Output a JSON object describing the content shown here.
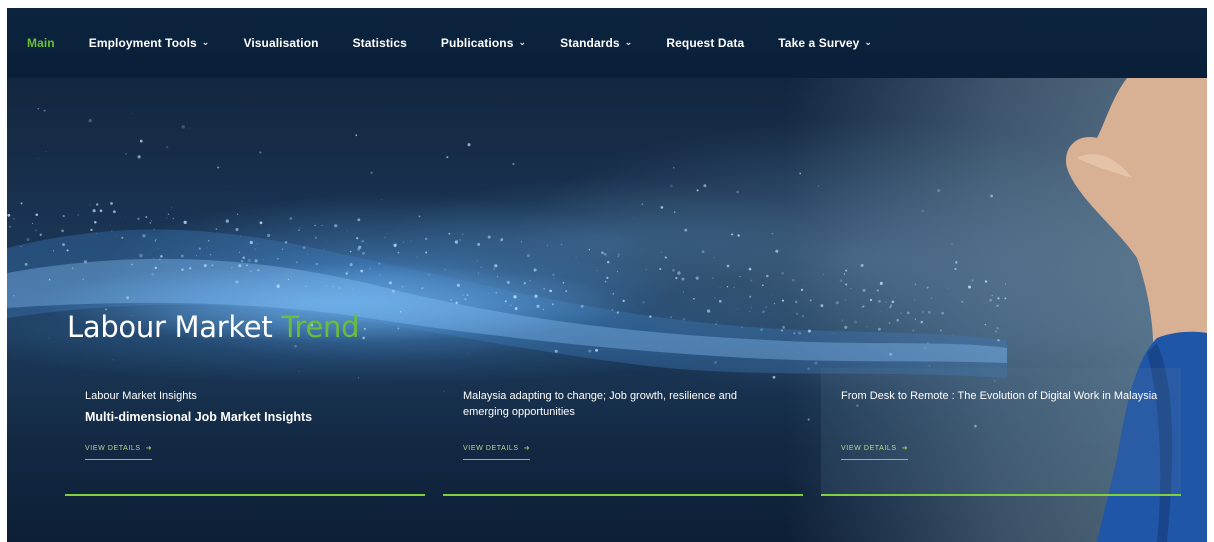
{
  "nav": {
    "items": [
      {
        "label": "Main",
        "active": true,
        "dropdown": false
      },
      {
        "label": "Employment Tools",
        "active": false,
        "dropdown": true
      },
      {
        "label": "Visualisation",
        "active": false,
        "dropdown": false
      },
      {
        "label": "Statistics",
        "active": false,
        "dropdown": false
      },
      {
        "label": "Publications",
        "active": false,
        "dropdown": true
      },
      {
        "label": "Standards",
        "active": false,
        "dropdown": true
      },
      {
        "label": "Request Data",
        "active": false,
        "dropdown": false
      },
      {
        "label": "Take a Survey",
        "active": false,
        "dropdown": true
      }
    ],
    "chevron_icon": "chevron-down-icon"
  },
  "hero": {
    "title_main": "Labour Market",
    "title_accent": "Trend"
  },
  "cards": [
    {
      "title": "Labour Market Insights",
      "subtitle": "Multi-dimensional Job Market Insights",
      "link_label": "VIEW DETAILS",
      "link_icon": "arrow-right-icon"
    },
    {
      "title": "Malaysia adapting to change; Job growth, resilience and emerging opportunities",
      "subtitle": "",
      "link_label": "VIEW DETAILS",
      "link_icon": "arrow-right-icon"
    },
    {
      "title": "From Desk to Remote : The Evolution of Digital Work in Malaysia",
      "subtitle": "",
      "link_label": "VIEW DETAILS",
      "link_icon": "arrow-right-icon"
    }
  ],
  "colors": {
    "navbar_bg": "#0a1f38",
    "accent_green": "#6abf3a",
    "card_underline": "#7fd13b",
    "text": "#ffffff"
  }
}
